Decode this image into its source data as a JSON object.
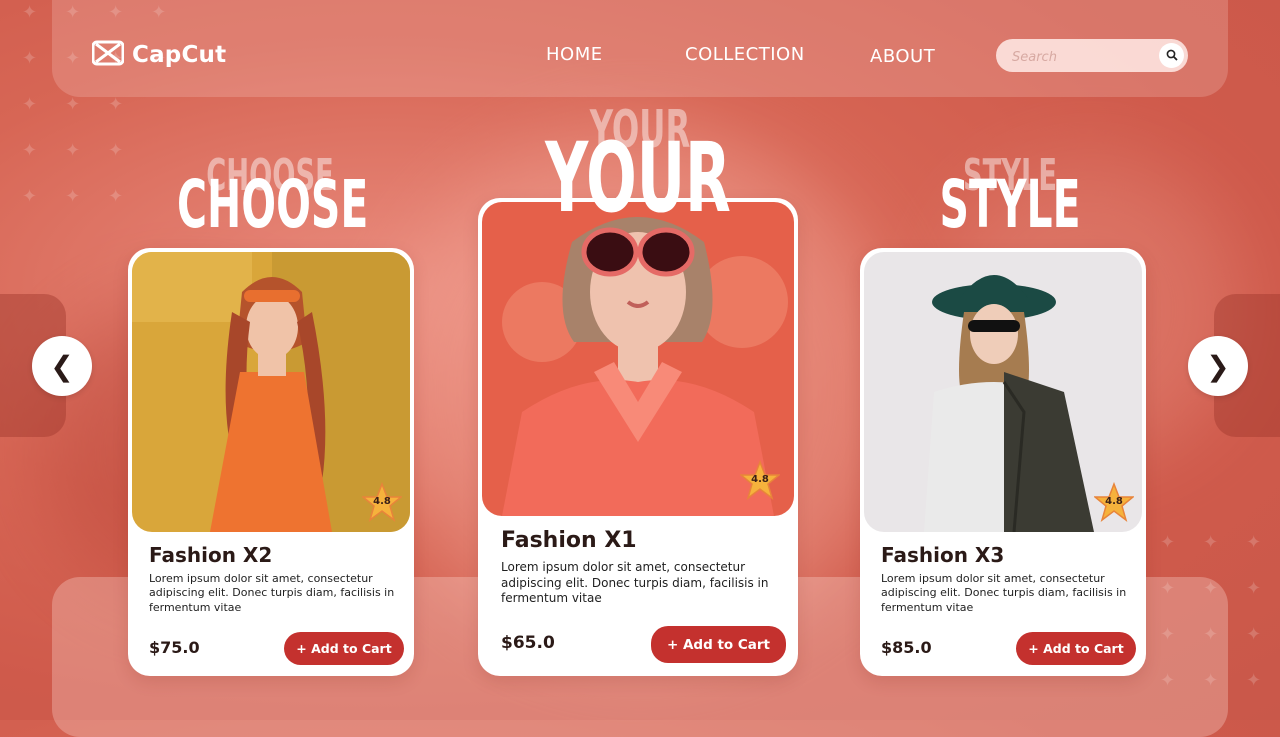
{
  "brand": {
    "name": "CapCut"
  },
  "nav": {
    "links": [
      "HOME",
      "COLLECTION",
      "ABOUT"
    ],
    "search_placeholder": "Search"
  },
  "hero": {
    "words": [
      "CHOOSE",
      "YOUR",
      "STYLE"
    ]
  },
  "carousel": {
    "prev_icon": "chevron-left-icon",
    "next_icon": "chevron-right-icon"
  },
  "products": [
    {
      "title": "Fashion X2",
      "description": "Lorem ipsum dolor sit amet, consectetur adipiscing elit. Donec turpis diam, facilisis in fermentum vitae",
      "price": "$75.0",
      "rating": "4.8",
      "cta": "+ Add to Cart"
    },
    {
      "title": "Fashion X1",
      "description": "Lorem ipsum dolor sit amet, consectetur adipiscing elit. Donec turpis diam, facilisis in fermentum vitae",
      "price": "$65.0",
      "rating": "4.8",
      "cta": "+ Add to Cart"
    },
    {
      "title": "Fashion X3",
      "description": "Lorem ipsum dolor sit amet, consectetur adipiscing elit. Donec turpis diam, facilisis in fermentum vitae",
      "price": "$85.0",
      "rating": "4.8",
      "cta": "+ Add to Cart"
    }
  ],
  "colors": {
    "accent": "#c4312e",
    "background": "#d76655",
    "star": "#f6b23c"
  }
}
